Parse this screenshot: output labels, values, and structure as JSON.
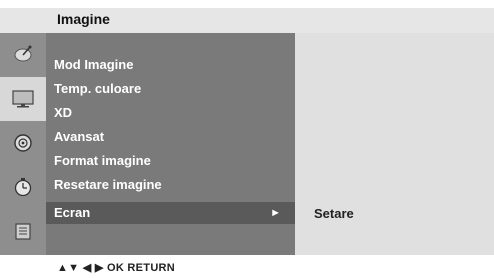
{
  "header": {
    "title": "Imagine"
  },
  "sidebar_icons": [
    {
      "name": "antenna-icon",
      "active": false
    },
    {
      "name": "tv-screen-icon",
      "active": true
    },
    {
      "name": "speaker-icon",
      "active": false
    },
    {
      "name": "clock-icon",
      "active": false
    },
    {
      "name": "lock-icon",
      "active": false
    }
  ],
  "menu": {
    "items": [
      {
        "label": "Mod Imagine"
      },
      {
        "label": "Temp. culoare"
      },
      {
        "label": "XD"
      },
      {
        "label": "Avansat"
      },
      {
        "label": "Format imagine"
      },
      {
        "label": "Resetare imagine"
      },
      {
        "label": "Ecran",
        "selected": true,
        "arrow": "►"
      }
    ]
  },
  "submenu": {
    "items": [
      {
        "label": "Setare"
      }
    ]
  },
  "footer": {
    "hint": "▲▼  ◀ ▶  OK  RETURN"
  },
  "colors": {
    "title_bar": "#e6e6e6",
    "icon_column": "#8e8e8e",
    "menu_panel": "#7a7a7a",
    "menu_selected": "#5a5a5a",
    "submenu_panel": "#e0e0e0"
  }
}
